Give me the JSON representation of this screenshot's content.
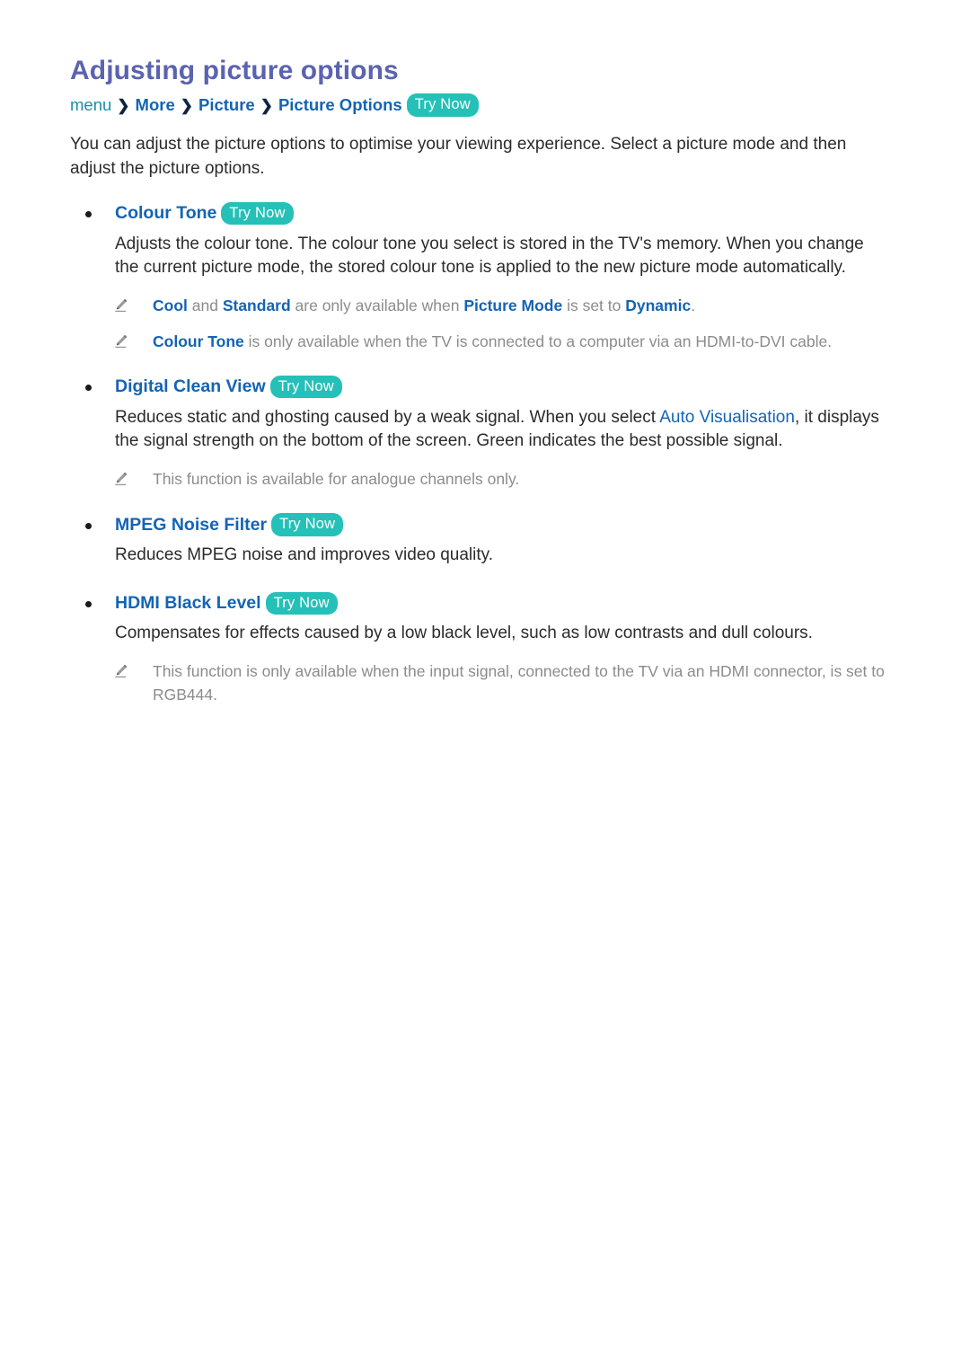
{
  "document": {
    "title": "Adjusting picture options",
    "colors": {
      "title": "#5b63b0",
      "link_blue": "#1464b4",
      "breadcrumb_first": "#1a8fa8",
      "try_now_badge": "#25c0b7",
      "body_text": "#2b2b2b",
      "note_text": "#8c8c8c",
      "background": "#ffffff"
    }
  },
  "breadcrumb": {
    "items": [
      {
        "label": "menu",
        "style": "first"
      },
      {
        "label": "More",
        "style": "link"
      },
      {
        "label": "Picture",
        "style": "link"
      },
      {
        "label": "Picture Options",
        "style": "link"
      }
    ],
    "separator": "❯",
    "try_now": "Try Now"
  },
  "intro": "You can adjust the picture options to optimise your viewing experience. Select a picture mode and then adjust the picture options.",
  "sections": [
    {
      "id": "colour-tone",
      "heading": "Colour Tone",
      "try_now": "Try Now",
      "body_parts": [
        {
          "text": "Adjusts the colour tone. The colour tone you select is stored in the TV's memory. When you change the current picture mode, the stored colour tone is applied to the new picture mode automatically.",
          "type": "plain"
        }
      ],
      "notes": [
        {
          "icon": "pencil-icon",
          "parts": [
            {
              "text": "Cool",
              "type": "key"
            },
            {
              "text": " and ",
              "type": "plain"
            },
            {
              "text": "Standard",
              "type": "key"
            },
            {
              "text": " are only available when ",
              "type": "plain"
            },
            {
              "text": "Picture Mode",
              "type": "key"
            },
            {
              "text": " is set to ",
              "type": "plain"
            },
            {
              "text": "Dynamic",
              "type": "key"
            },
            {
              "text": ".",
              "type": "plain"
            }
          ]
        },
        {
          "icon": "pencil-icon",
          "parts": [
            {
              "text": "Colour Tone",
              "type": "key"
            },
            {
              "text": " is only available when the TV is connected to a computer via an HDMI-to-DVI cable.",
              "type": "plain"
            }
          ]
        }
      ]
    },
    {
      "id": "digital-clean-view",
      "heading": "Digital Clean View",
      "try_now": "Try Now",
      "body_parts": [
        {
          "text": "Reduces static and ghosting caused by a weak signal. When you select ",
          "type": "plain"
        },
        {
          "text": "Auto Visualisation",
          "type": "highlight"
        },
        {
          "text": ", it displays the signal strength on the bottom of the screen. Green indicates the best possible signal.",
          "type": "plain"
        }
      ],
      "notes": [
        {
          "icon": "pencil-icon",
          "parts": [
            {
              "text": "This function is available for analogue channels only.",
              "type": "plain"
            }
          ]
        }
      ]
    },
    {
      "id": "mpeg-noise-filter",
      "heading": "MPEG Noise Filter",
      "try_now": "Try Now",
      "body_parts": [
        {
          "text": "Reduces MPEG noise and improves video quality.",
          "type": "plain"
        }
      ],
      "notes": []
    },
    {
      "id": "hdmi-black-level",
      "heading": "HDMI Black Level",
      "try_now": "Try Now",
      "body_parts": [
        {
          "text": "Compensates for effects caused by a low black level, such as low contrasts and dull colours.",
          "type": "plain"
        }
      ],
      "notes": [
        {
          "icon": "pencil-icon",
          "parts": [
            {
              "text": "This function is only available when the input signal, connected to the TV via an HDMI connector, is set to RGB444.",
              "type": "plain"
            }
          ]
        }
      ]
    }
  ]
}
